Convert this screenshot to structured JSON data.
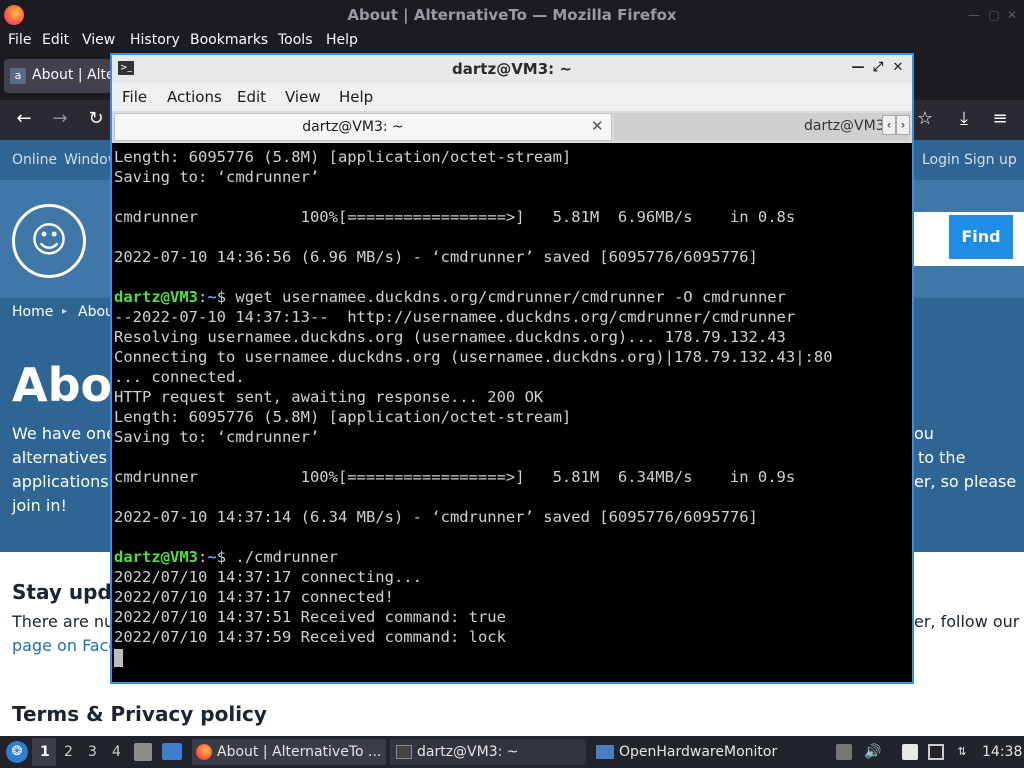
{
  "firefox": {
    "title": "About | AlternativeTo — Mozilla Firefox",
    "menu": [
      "File",
      "Edit",
      "View",
      "History",
      "Bookmarks",
      "Tools",
      "Help"
    ],
    "tab_label": "About | Alte",
    "tab_favicon": "a"
  },
  "site": {
    "top_links": [
      "Online",
      "Window"
    ],
    "login": "Login",
    "signup": "Sign up",
    "find_label": "Find",
    "breadcrumb": [
      "Home",
      "Abou"
    ],
    "heading": "Abou",
    "intro_lines_left": [
      "We have one r",
      "alternatives to",
      "applications y",
      "join in!"
    ],
    "intro_lines_right": [
      "ou",
      "to the",
      "er, so please"
    ],
    "stay_heading": "Stay upda",
    "stay_left": "There are num",
    "stay_right": "er, follow our",
    "facebook_link": "page on Faceb",
    "terms_heading": "Terms & Privacy policy"
  },
  "terminal": {
    "title": "dartz@VM3: ~",
    "menu": [
      "File",
      "Actions",
      "Edit",
      "View",
      "Help"
    ],
    "tab1": "dartz@VM3: ~",
    "tab2": "dartz@VM3: ~",
    "prompt_user": "dartz@VM3",
    "prompt_sep": ":",
    "prompt_path": "~",
    "prompt_dollar": "$ ",
    "lines": [
      "Length: 6095776 (5.8M) [application/octet-stream]",
      "Saving to: ‘cmdrunner’",
      "",
      "cmdrunner           100%[=================>]   5.81M  6.96MB/s    in 0.8s",
      "",
      "2022-07-10 14:36:56 (6.96 MB/s) - ‘cmdrunner’ saved [6095776/6095776]",
      "",
      "",
      "--2022-07-10 14:37:13--  http://usernamee.duckdns.org/cmdrunner/cmdrunner",
      "Resolving usernamee.duckdns.org (usernamee.duckdns.org)... 178.79.132.43",
      "Connecting to usernamee.duckdns.org (usernamee.duckdns.org)|178.79.132.43|:80",
      "... connected.",
      "HTTP request sent, awaiting response... 200 OK",
      "Length: 6095776 (5.8M) [application/octet-stream]",
      "Saving to: ‘cmdrunner’",
      "",
      "cmdrunner           100%[=================>]   5.81M  6.34MB/s    in 0.9s",
      "",
      "2022-07-10 14:37:14 (6.34 MB/s) - ‘cmdrunner’ saved [6095776/6095776]",
      "",
      "",
      "2022/07/10 14:37:17 connecting...",
      "2022/07/10 14:37:17 connected!",
      "2022/07/10 14:37:51 Received command: true",
      "2022/07/10 14:37:59 Received command: lock"
    ],
    "cmd1": "wget usernamee.duckdns.org/cmdrunner/cmdrunner -O cmdrunner",
    "cmd2": "./cmdrunner"
  },
  "taskbar": {
    "workspaces": [
      "1",
      "2",
      "3",
      "4"
    ],
    "tasks": [
      "About | AlternativeTo ...",
      "dartz@VM3: ~",
      "OpenHardwareMonitor"
    ],
    "clock": "14:38"
  },
  "colors": {
    "terminal_accent": "#3d8ee0",
    "prompt_user": "#4fe03c",
    "prompt_path": "#5aa0f0",
    "site_blue": "#2e6592",
    "find_button": "#1f8ce6"
  }
}
